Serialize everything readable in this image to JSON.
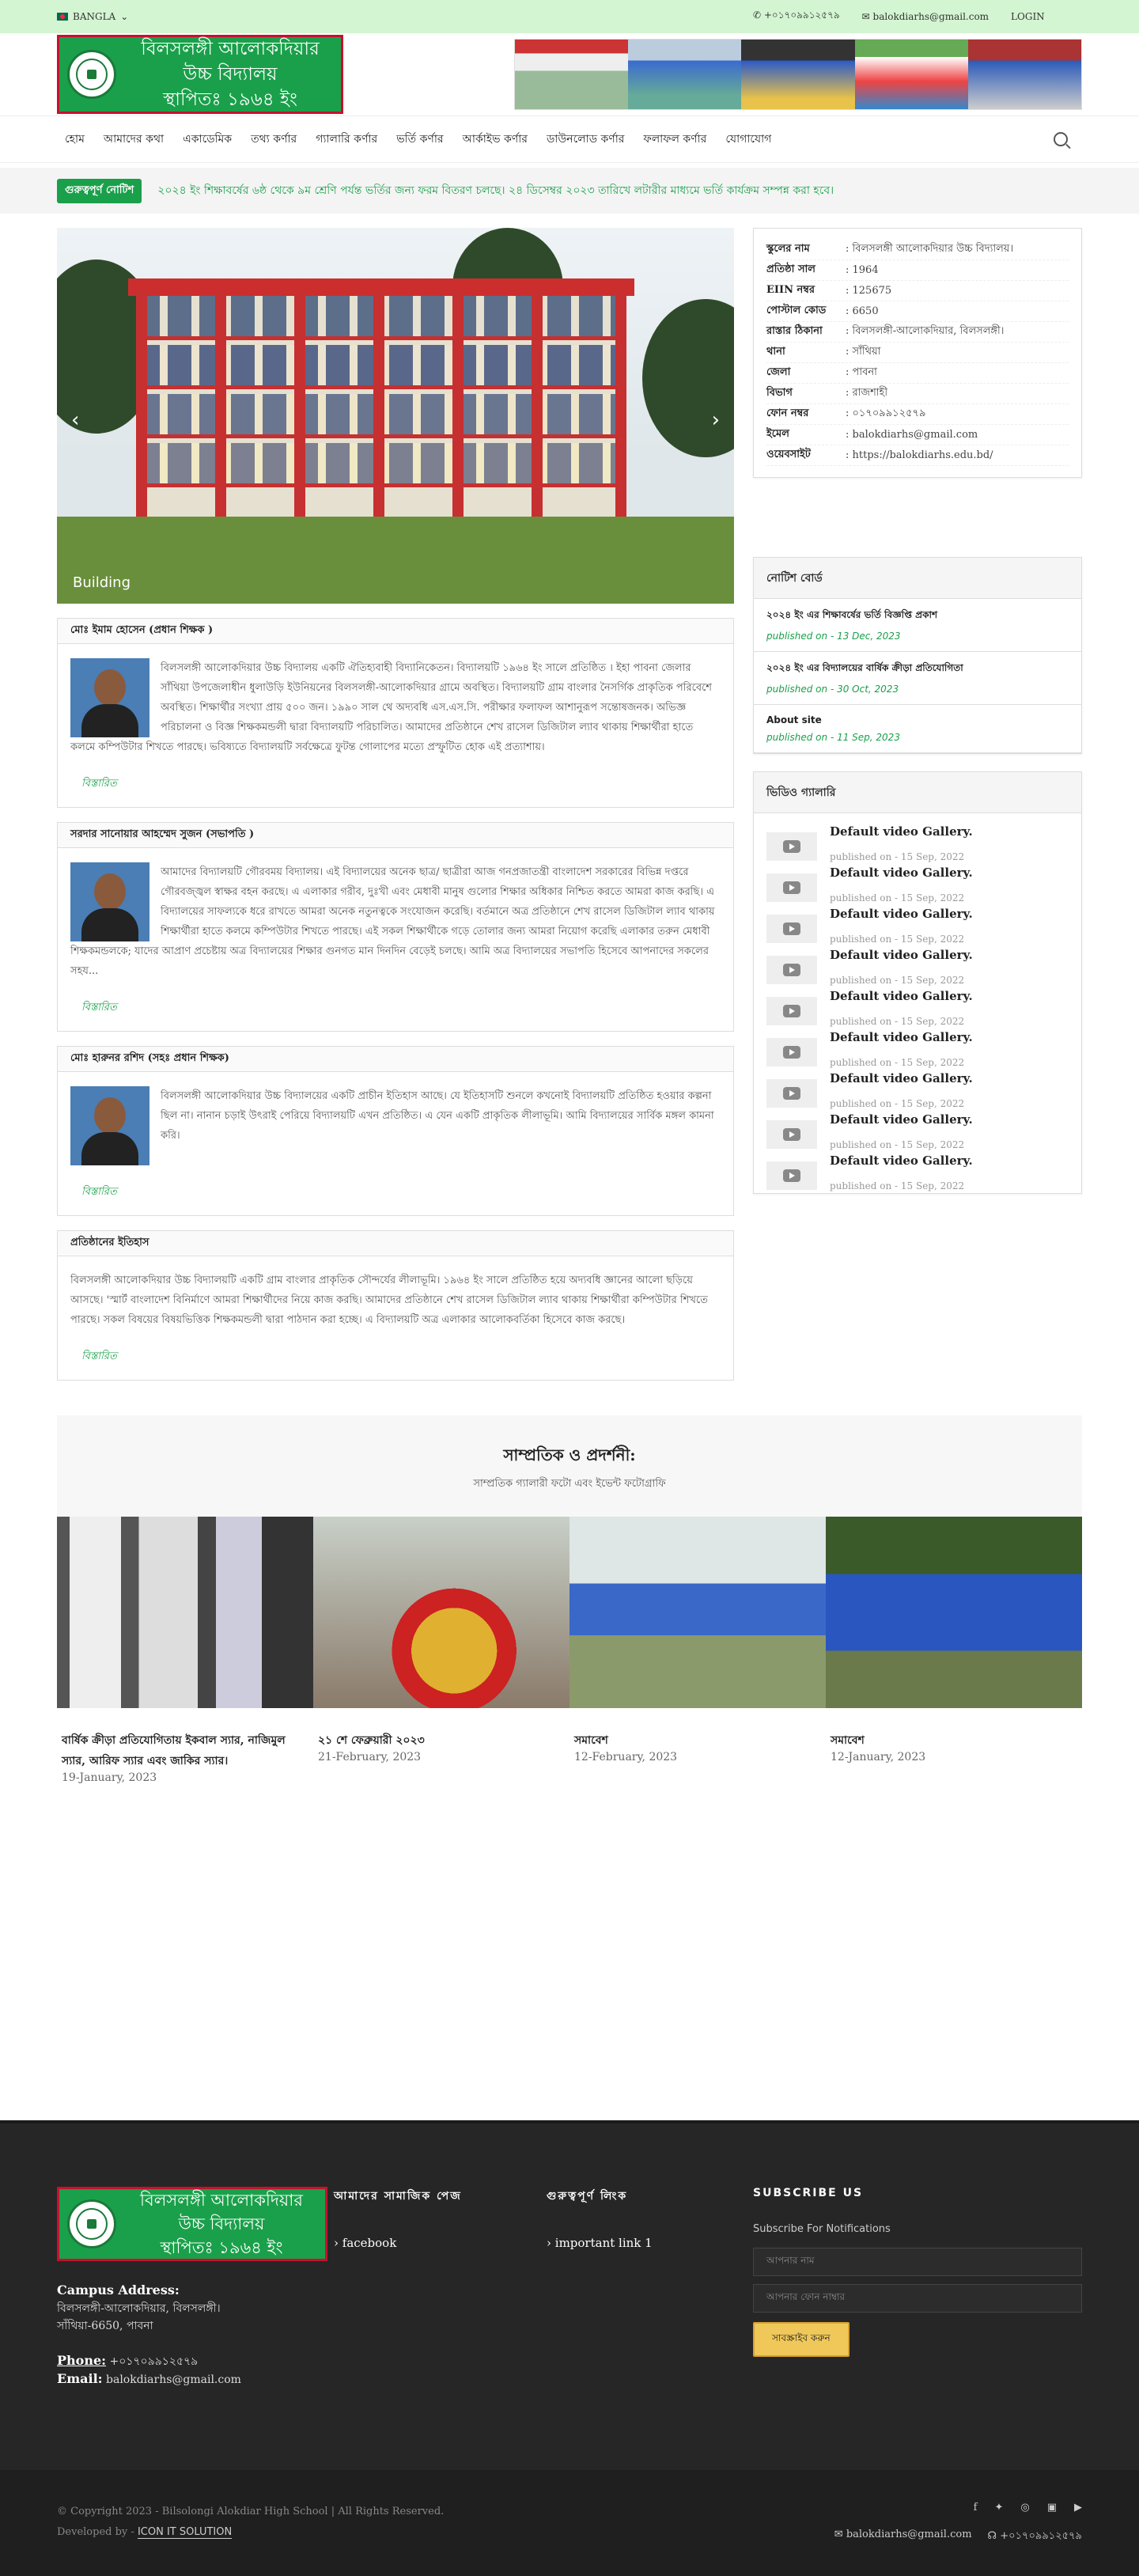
{
  "topbar": {
    "language": "BANGLA",
    "phone": "+০১৭০৯৯১২৫৭৯",
    "email": "balokdiarhs@gmail.com",
    "login": "LOGIN"
  },
  "header": {
    "logo_line1": "বিলসলঙ্গী আলোকদিয়ার",
    "logo_line2": "উচ্চ বিদ্যালয়",
    "logo_line3": "স্থাপিতঃ ১৯৬৪ ইং"
  },
  "nav": [
    "হোম",
    "আমাদের কথা",
    "একাডেমিক",
    "তথ্য কর্ণার",
    "গ্যালারি কর্ণার",
    "ভর্তি কর্ণার",
    "আর্কাইভ কর্ণার",
    "ডাউনলোড কর্ণার",
    "ফলাফল কর্ণার",
    "যোগাযোগ"
  ],
  "notice": {
    "tag": "গুরুত্বপূর্ণ নোটিশ",
    "text": "২০২৪ ইং শিক্ষাবর্ষের ৬ষ্ঠ থেকে ৯ম শ্রেণি পর্যন্ত ভর্তির জন্য ফরম বিতরণ চলছে। ২৪ ডিসেম্বর ২০২৩ তারিখে লটারীর মাধ্যমে ভর্তি কার্যক্রম সম্পন্ন করা হবে।"
  },
  "slider": {
    "caption": "Building",
    "prev": "‹",
    "next": "›"
  },
  "cards": [
    {
      "title": "মোঃ ইমাম হোসেন (প্রধান শিক্ষক )",
      "text": "বিলসলঙ্গী আলোকদিয়ার উচ্চ বিদ্যালয় একটি ঐতিহ্যবাহী বিদ্যানিকেতন। বিদ্যালয়টি ১৯৬৪ ইং সালে প্রতিষ্ঠিত । ইহা পাবনা জেলার সাঁথিয়া উপজেলাধীন ধুলাউড়ি ইউনিয়নের বিলসলঙ্গী-আলোকদিয়ার গ্রামে অবস্থিত। বিদ্যালয়টি গ্রাম বাংলার নৈসর্গিক প্রাকৃতিক পরিবেশে অবস্থিত। শিক্ষার্থীর সংখ্যা প্রায় ৫০০ জন। ১৯৯০ সাল থে অদ্যবধি এস.এস.সি. পরীক্ষার ফলাফল আশানুরূপ সন্তোষজনক। অভিজ্ঞ পরিচালনা ও বিজ্ঞ শিক্ষকমন্ডলী দ্বারা বিদ্যালয়টি পরিচালিত। আমাদের প্রতিষ্ঠানে শেখ রাসেল ডিজিটাল ল্যাব থাকায় শিক্ষার্থীরা হাতে কলমে কম্পিউটার শিখতে পারছে। ভবিষ্যতে বিদ্যালয়টি সর্বক্ষেত্রে ফুটন্ত গোলাপের মত্যে প্রস্ফুটিত হোক এই প্রত্যাশায়।",
      "more": "বিস্তারিত"
    },
    {
      "title": "সরদার সানোয়ার আহম্মেদ সুজন (সভাপতি )",
      "text": "আমাদের বিদ্যালয়টি গৌরবময় বিদ্যালয়। এই বিদ্যালয়ের অনেক ছাত্র/ ছাত্রীরা আজ গনপ্রজাতন্ত্রী বাংলাদেশ সরকারের বিভিন্ন দপ্তরে গৌরবজ্জ্বল স্বাক্ষর বহন করছে। এ এলাকার গরীব, দুঃখী এবং মেধাবী মানুষ গুলোর শিক্ষার অধিকার নিশ্চিত করতে আমরা কাজ করছি। এ বিদ্যালয়ের সাফল্যকে ধরে রাখতে আমরা অনেক নতুনত্বকে সংযোজন করেছি। বর্তমানে অত্র প্রতিষ্ঠানে শেখ রাসেল ডিজিটাল ল্যাব থাকায় শিক্ষার্থীরা হাতে কলমে কম্পিউটার শিখতে পারছে। এই সকল শিক্ষার্থীকে গড়ে তোলার জন্য আমরা নিয়োগ করেছি এলাকার তরুন মেধাবী শিক্ষকমন্ডলকে; যাদের আপ্রাণ প্রচেষ্টায় অত্র বিদ্যালয়ের শিক্ষার গুনগত মান দিনদিন বেড়েই চলছে। আমি অত্র বিদ্যালয়ের সভাপতি হিসেবে আপনাদের সকলের সহয...",
      "more": "বিস্তারিত"
    },
    {
      "title": "মোঃ হারুনর রশিদ (সহঃ প্রধান শিক্ষক)",
      "text": "বিলসলঙ্গী আলোকদিয়ার উচ্চ বিদ্যালয়ের একটি প্রাচীন ইতিহাস আছে। যে ইতিহাসটি শুনলে কখনোই বিদ্যালয়টি প্রতিষ্ঠিত হওয়ার কল্পনা ছিল না। নানান চড়াই উৎরাই পেরিয়ে বিদ্যালয়টি এখন প্রতিষ্ঠিত। এ যেন একটি প্রাকৃতিক লীলাভূমি। আমি বিদ্যালয়ের সার্বিক মঙ্গল কামনা করি।",
      "more": "বিস্তারিত"
    },
    {
      "title": "প্রতিষ্ঠানের ইতিহাস",
      "text": "বিলসলঙ্গী আলোকদিয়ার উচ্চ বিদ্যালয়টি একটি গ্রাম বাংলার প্রাকৃতিক সৌন্দর্যের লীলাভূমি। ১৯৬৪ ইং সালে প্রতিষ্ঠিত হয়ে অদ্যবধি জ্ঞানের আলো ছড়িয়ে আসছে। 'স্মার্ট বাংলাদেশ বিনির্মাণে আমরা শিক্ষার্থীদের নিয়ে কাজ করছি। আমাদের প্রতিষ্ঠানে শেখ রাসেল ডিজিটাল ল্যাব থাকায় শিক্ষার্থীরা কম্পিউটার শিখতে পারছে। সকল বিষয়ের বিষয়ভিত্তিক শিক্ষকমন্ডলী দ্বারা পাঠদান করা হচ্ছে। এ বিদ্যালয়টি অত্র এলাকার আলোকবর্তিকা হিসেবে কাজ করছে।",
      "more": "বিস্তারিত"
    }
  ],
  "info": [
    {
      "k": "স্কুলের নাম",
      "v": ": বিলসলঙ্গী আলোকদিয়ার উচ্চ বিদ্যালয়।"
    },
    {
      "k": "প্রতিষ্ঠা সাল",
      "v": ": 1964"
    },
    {
      "k": "EIIN নম্বর",
      "v": ": 125675"
    },
    {
      "k": "পোস্টাল কোড",
      "v": ": 6650"
    },
    {
      "k": "রাস্তার ঠিকানা",
      "v": ": বিলসলঙ্গী-আলোকদিয়ার, বিলসলঙ্গী।"
    },
    {
      "k": "থানা",
      "v": ": সাঁথিয়া"
    },
    {
      "k": "জেলা",
      "v": ": পাবনা"
    },
    {
      "k": "বিভাগ",
      "v": ": রাজশাহী"
    },
    {
      "k": "ফোন নম্বর",
      "v": ": ০১৭০৯৯১২৫৭৯"
    },
    {
      "k": "ইমেল",
      "v": ": balokdiarhs@gmail.com"
    },
    {
      "k": "ওয়েবসাইট",
      "v": ": https://balokdiarhs.edu.bd/"
    }
  ],
  "notices_box": {
    "title": "নোটিশ বোর্ড",
    "items": [
      {
        "t": "২০২৪ ইং এর শিক্ষাবর্ষের ভর্তি বিজ্ঞপ্তি প্রকাশ",
        "d": "published on - 13 Dec, 2023"
      },
      {
        "t": "২০২৪ ইং এর বিদ্যালয়ের বার্ষিক ক্রীড়া প্রতিযোগিতা",
        "d": "published on - 30 Oct, 2023"
      },
      {
        "t": "About site",
        "d": "published on - 11 Sep, 2023"
      }
    ]
  },
  "videos": {
    "title": "ভিডিও গ্যালারি",
    "items": [
      {
        "t": "Default video Gallery.",
        "d": "published on - 15 Sep, 2022"
      },
      {
        "t": "Default video Gallery.",
        "d": "published on - 15 Sep, 2022"
      },
      {
        "t": "Default video Gallery.",
        "d": "published on - 15 Sep, 2022"
      },
      {
        "t": "Default video Gallery.",
        "d": "published on - 15 Sep, 2022"
      },
      {
        "t": "Default video Gallery.",
        "d": "published on - 15 Sep, 2022"
      },
      {
        "t": "Default video Gallery.",
        "d": "published on - 15 Sep, 2022"
      },
      {
        "t": "Default video Gallery.",
        "d": "published on - 15 Sep, 2022"
      },
      {
        "t": "Default video Gallery.",
        "d": "published on - 15 Sep, 2022"
      },
      {
        "t": "Default video Gallery.",
        "d": "published on - 15 Sep, 2022"
      }
    ]
  },
  "gallery": {
    "title": "সাম্প্রতিক ও প্রদর্শনী:",
    "subtitle": "সাম্প্রতিক গ্যালারী ফটো এবং ইভেন্ট ফটোগ্রাফি",
    "items": [
      {
        "t": "বার্ষিক ক্রীড়া প্রতিযোগিতায় ইকবাল স্যার, নাজিমুল স্যার, আরিফ স্যার এবং জাকির স্যার।",
        "d": "19-January, 2023"
      },
      {
        "t": "২১ শে ফেব্রুয়ারী ২০২৩",
        "d": "21-February, 2023"
      },
      {
        "t": "সমাবেশ",
        "d": "12-February, 2023"
      },
      {
        "t": "সমাবেশ",
        "d": "12-January, 2023"
      }
    ]
  },
  "footer": {
    "logo_line1": "বিলসলঙ্গী আলোকদিয়ার",
    "logo_line2": "উচ্চ বিদ্যালয়",
    "logo_line3": "স্থাপিতঃ ১৯৬৪ ইং",
    "campus_label": "Campus Address:",
    "addr1": "বিলসলঙ্গী-আলোকদিয়ার, বিলসলঙ্গী।",
    "addr2": "সাঁথিয়া-6650, পাবনা",
    "phone_label": "Phone:",
    "phone": "+০১৭০৯৯১২৫৭৯",
    "email_label": "Email:",
    "email": "balokdiarhs@gmail.com",
    "col2_title": "আমাদের সামাজিক পেজ",
    "col2_link": "facebook",
    "col3_title": "গুরুত্বপূর্ণ লিংক",
    "col3_link": "important link 1",
    "sub_title": "SUBSCRIBE US",
    "sub_text": "Subscribe For Notifications",
    "name_ph": "আপনার নাম",
    "phone_ph": "আপনার ফোন নাম্বার",
    "sub_btn": "সাবস্ক্রাইব করুন",
    "copyright": "© Copyright 2023 - Bilsolongi Alokdiar High School | All Rights Reserved.",
    "dev_label": "Developed by -",
    "dev": "ICON IT SOLUTION",
    "c_email": "balokdiarhs@gmail.com",
    "c_phone": "+০১৭০৯৯১২৫৭৯"
  }
}
